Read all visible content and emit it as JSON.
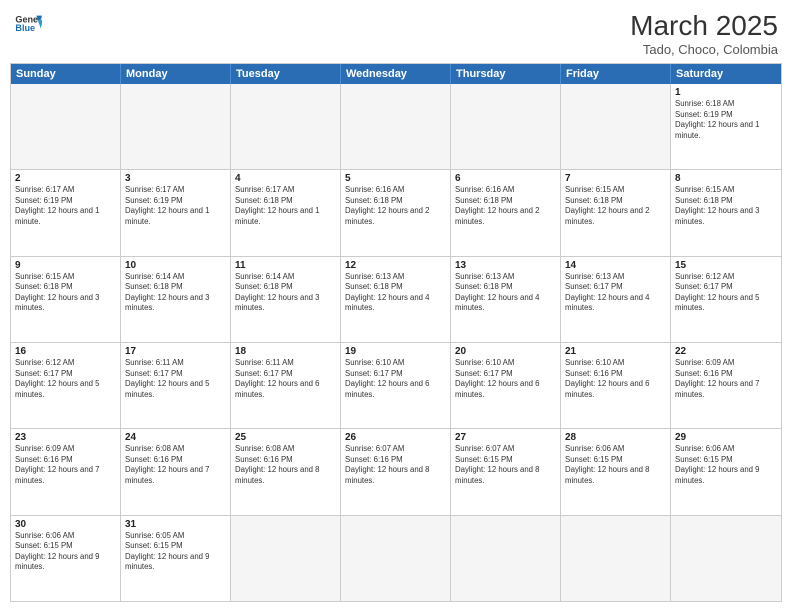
{
  "header": {
    "logo_general": "General",
    "logo_blue": "Blue",
    "month_title": "March 2025",
    "location": "Tado, Choco, Colombia"
  },
  "weekdays": [
    "Sunday",
    "Monday",
    "Tuesday",
    "Wednesday",
    "Thursday",
    "Friday",
    "Saturday"
  ],
  "rows": [
    [
      {
        "day": "",
        "text": ""
      },
      {
        "day": "",
        "text": ""
      },
      {
        "day": "",
        "text": ""
      },
      {
        "day": "",
        "text": ""
      },
      {
        "day": "",
        "text": ""
      },
      {
        "day": "",
        "text": ""
      },
      {
        "day": "1",
        "text": "Sunrise: 6:18 AM\nSunset: 6:19 PM\nDaylight: 12 hours and 1 minute."
      }
    ],
    [
      {
        "day": "2",
        "text": "Sunrise: 6:17 AM\nSunset: 6:19 PM\nDaylight: 12 hours and 1 minute."
      },
      {
        "day": "3",
        "text": "Sunrise: 6:17 AM\nSunset: 6:19 PM\nDaylight: 12 hours and 1 minute."
      },
      {
        "day": "4",
        "text": "Sunrise: 6:17 AM\nSunset: 6:18 PM\nDaylight: 12 hours and 1 minute."
      },
      {
        "day": "5",
        "text": "Sunrise: 6:16 AM\nSunset: 6:18 PM\nDaylight: 12 hours and 2 minutes."
      },
      {
        "day": "6",
        "text": "Sunrise: 6:16 AM\nSunset: 6:18 PM\nDaylight: 12 hours and 2 minutes."
      },
      {
        "day": "7",
        "text": "Sunrise: 6:15 AM\nSunset: 6:18 PM\nDaylight: 12 hours and 2 minutes."
      },
      {
        "day": "8",
        "text": "Sunrise: 6:15 AM\nSunset: 6:18 PM\nDaylight: 12 hours and 3 minutes."
      }
    ],
    [
      {
        "day": "9",
        "text": "Sunrise: 6:15 AM\nSunset: 6:18 PM\nDaylight: 12 hours and 3 minutes."
      },
      {
        "day": "10",
        "text": "Sunrise: 6:14 AM\nSunset: 6:18 PM\nDaylight: 12 hours and 3 minutes."
      },
      {
        "day": "11",
        "text": "Sunrise: 6:14 AM\nSunset: 6:18 PM\nDaylight: 12 hours and 3 minutes."
      },
      {
        "day": "12",
        "text": "Sunrise: 6:13 AM\nSunset: 6:18 PM\nDaylight: 12 hours and 4 minutes."
      },
      {
        "day": "13",
        "text": "Sunrise: 6:13 AM\nSunset: 6:18 PM\nDaylight: 12 hours and 4 minutes."
      },
      {
        "day": "14",
        "text": "Sunrise: 6:13 AM\nSunset: 6:17 PM\nDaylight: 12 hours and 4 minutes."
      },
      {
        "day": "15",
        "text": "Sunrise: 6:12 AM\nSunset: 6:17 PM\nDaylight: 12 hours and 5 minutes."
      }
    ],
    [
      {
        "day": "16",
        "text": "Sunrise: 6:12 AM\nSunset: 6:17 PM\nDaylight: 12 hours and 5 minutes."
      },
      {
        "day": "17",
        "text": "Sunrise: 6:11 AM\nSunset: 6:17 PM\nDaylight: 12 hours and 5 minutes."
      },
      {
        "day": "18",
        "text": "Sunrise: 6:11 AM\nSunset: 6:17 PM\nDaylight: 12 hours and 6 minutes."
      },
      {
        "day": "19",
        "text": "Sunrise: 6:10 AM\nSunset: 6:17 PM\nDaylight: 12 hours and 6 minutes."
      },
      {
        "day": "20",
        "text": "Sunrise: 6:10 AM\nSunset: 6:17 PM\nDaylight: 12 hours and 6 minutes."
      },
      {
        "day": "21",
        "text": "Sunrise: 6:10 AM\nSunset: 6:16 PM\nDaylight: 12 hours and 6 minutes."
      },
      {
        "day": "22",
        "text": "Sunrise: 6:09 AM\nSunset: 6:16 PM\nDaylight: 12 hours and 7 minutes."
      }
    ],
    [
      {
        "day": "23",
        "text": "Sunrise: 6:09 AM\nSunset: 6:16 PM\nDaylight: 12 hours and 7 minutes."
      },
      {
        "day": "24",
        "text": "Sunrise: 6:08 AM\nSunset: 6:16 PM\nDaylight: 12 hours and 7 minutes."
      },
      {
        "day": "25",
        "text": "Sunrise: 6:08 AM\nSunset: 6:16 PM\nDaylight: 12 hours and 8 minutes."
      },
      {
        "day": "26",
        "text": "Sunrise: 6:07 AM\nSunset: 6:16 PM\nDaylight: 12 hours and 8 minutes."
      },
      {
        "day": "27",
        "text": "Sunrise: 6:07 AM\nSunset: 6:15 PM\nDaylight: 12 hours and 8 minutes."
      },
      {
        "day": "28",
        "text": "Sunrise: 6:06 AM\nSunset: 6:15 PM\nDaylight: 12 hours and 8 minutes."
      },
      {
        "day": "29",
        "text": "Sunrise: 6:06 AM\nSunset: 6:15 PM\nDaylight: 12 hours and 9 minutes."
      }
    ],
    [
      {
        "day": "30",
        "text": "Sunrise: 6:06 AM\nSunset: 6:15 PM\nDaylight: 12 hours and 9 minutes."
      },
      {
        "day": "31",
        "text": "Sunrise: 6:05 AM\nSunset: 6:15 PM\nDaylight: 12 hours and 9 minutes."
      },
      {
        "day": "",
        "text": ""
      },
      {
        "day": "",
        "text": ""
      },
      {
        "day": "",
        "text": ""
      },
      {
        "day": "",
        "text": ""
      },
      {
        "day": "",
        "text": ""
      }
    ]
  ]
}
